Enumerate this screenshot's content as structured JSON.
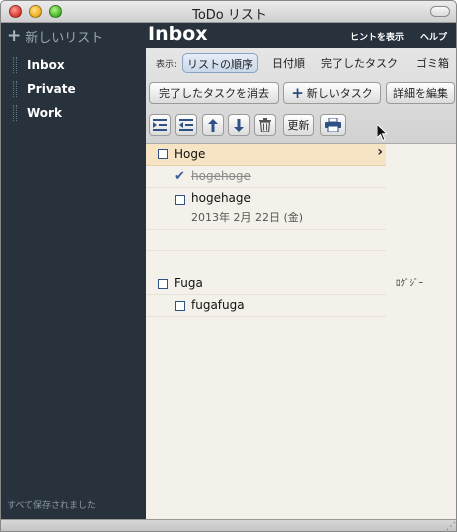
{
  "window": {
    "title": "ToDo リスト"
  },
  "sidebar": {
    "new_list_label": "新しいリスト",
    "lists": [
      {
        "label": "Inbox"
      },
      {
        "label": "Private"
      },
      {
        "label": "Work"
      }
    ],
    "status": "すべて保存されました"
  },
  "header": {
    "title": "Inbox",
    "hint": "ヒントを表示",
    "help": "ヘルプ"
  },
  "sort": {
    "label": "表示:",
    "options": [
      "リストの順序",
      "日付順",
      "完了したタスク",
      "ゴミ箱"
    ],
    "selected": "リストの順序"
  },
  "actions": {
    "clear_done": "完了したタスクを消去",
    "new_task": "新しいタスク",
    "edit_details": "詳細を編集"
  },
  "icon_toolbar": {
    "icons": [
      "indent-icon",
      "outdent-icon",
      "move-up-icon",
      "move-down-icon",
      "trash-icon",
      "print-icon"
    ],
    "refresh": "更新"
  },
  "tasks": {
    "groups": [
      {
        "name": "Hoge",
        "items": [
          {
            "name": "hogehoge",
            "done": true
          },
          {
            "name": "hogehage",
            "done": false,
            "date": "2013年 2月 22日 (金)"
          }
        ]
      },
      {
        "name": "Fuga",
        "items": [
          {
            "name": "fugafuga",
            "done": false
          }
        ]
      }
    ]
  },
  "side_note": "ﾛｸﾞｼﾞｰ",
  "colors": {
    "sidebar_bg": "#27323d",
    "selected_row": "#f6e4c5",
    "content_bg": "#f4f1ea",
    "checkbox_border": "#2f5286"
  }
}
